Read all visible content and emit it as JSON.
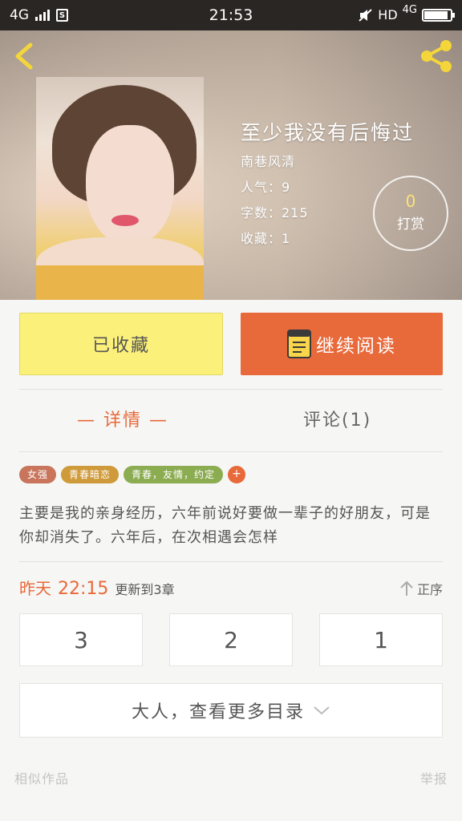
{
  "status_bar": {
    "network": "4G",
    "time": "21:53",
    "right_network": "HD",
    "right_4g": "4G",
    "sim_label": "S"
  },
  "book": {
    "title": "至少我没有后悔过",
    "author": "南巷风清",
    "popularity": "人气：9",
    "word_count": "字数：215",
    "favorites": "收藏：1"
  },
  "reward": {
    "count": "0",
    "label": "打赏"
  },
  "actions": {
    "favorited_label": "已收藏",
    "continue_label": "继续阅读"
  },
  "tabs": {
    "details": "— 详情 —",
    "comments": "评论(1)"
  },
  "tags": [
    {
      "label": "女强",
      "color": "#c8755c"
    },
    {
      "label": "青春暗恋",
      "color": "#cf9a3a"
    },
    {
      "label": "青春，友情，约定",
      "color": "#8cac52"
    }
  ],
  "tag_add": "+",
  "description": "主要是我的亲身经历，六年前说好要做一辈子的好朋友，可是你却消失了。六年后，在次相遇会怎样",
  "update": {
    "day": "昨天",
    "time": "22:15",
    "text": "更新到3章"
  },
  "sort_label": "正序",
  "chapters": [
    "3",
    "2",
    "1"
  ],
  "more_label": "大人，查看更多目录",
  "footer": {
    "similar": "相似作品",
    "report": "举报"
  },
  "colors": {
    "accent": "#e8693a",
    "fav_button": "#fbf07a",
    "status_bar": "#2a2624"
  }
}
